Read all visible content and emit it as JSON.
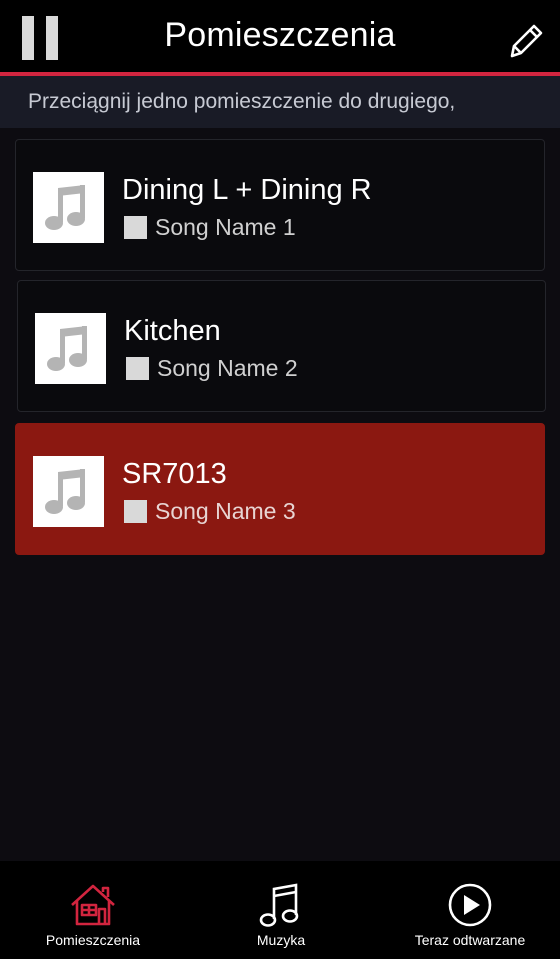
{
  "header": {
    "title": "Pomieszczenia",
    "accent_color": "#d2253f",
    "left_icon": "pause-icon",
    "right_icon": "pencil-icon"
  },
  "banner": {
    "text": "Przeciągnij jedno pomieszczenie do drugiego,"
  },
  "rooms": [
    {
      "name": "Dining L + Dining R",
      "song": "Song Name 1",
      "selected": false,
      "icon": "music-note-icon"
    },
    {
      "name": "Kitchen",
      "song": "Song Name 2",
      "selected": false,
      "icon": "music-note-icon"
    },
    {
      "name": "SR7013",
      "song": "Song Name 3",
      "selected": true,
      "icon": "music-note-icon",
      "selected_color": "#8b1811"
    }
  ],
  "tabbar": {
    "tabs": [
      {
        "label": "Pomieszczenia",
        "icon": "house-icon",
        "active": true
      },
      {
        "label": "Muzyka",
        "icon": "music-notes-icon",
        "active": false
      },
      {
        "label": "Teraz odtwarzane",
        "icon": "play-circle-icon",
        "active": false
      }
    ]
  }
}
